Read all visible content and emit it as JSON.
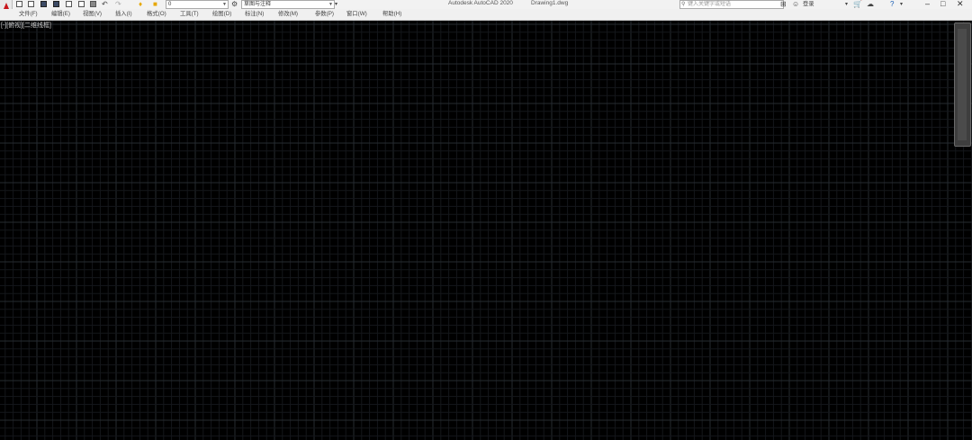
{
  "window": {
    "app_title": "Autodesk AutoCAD 2020",
    "file_name": "Drawing1.dwg"
  },
  "quick_access": {
    "layer_value": "0",
    "workspace_value": "草图与注释"
  },
  "search": {
    "placeholder": "键入关键字或短语"
  },
  "login_label": "登录",
  "menu": [
    "文件(F)",
    "编辑(E)",
    "视图(V)",
    "插入(I)",
    "格式(O)",
    "工具(T)",
    "绘图(D)",
    "标注(N)",
    "修改(M)",
    "参数(P)",
    "窗口(W)",
    "帮助(H)"
  ],
  "viewport": {
    "label": "[-][俯视][二维线框]"
  },
  "colors": {
    "canvas": "#000000",
    "grid_major": "#262b31",
    "grid_minor": "#14171b",
    "app_accent": "#c8151b"
  }
}
